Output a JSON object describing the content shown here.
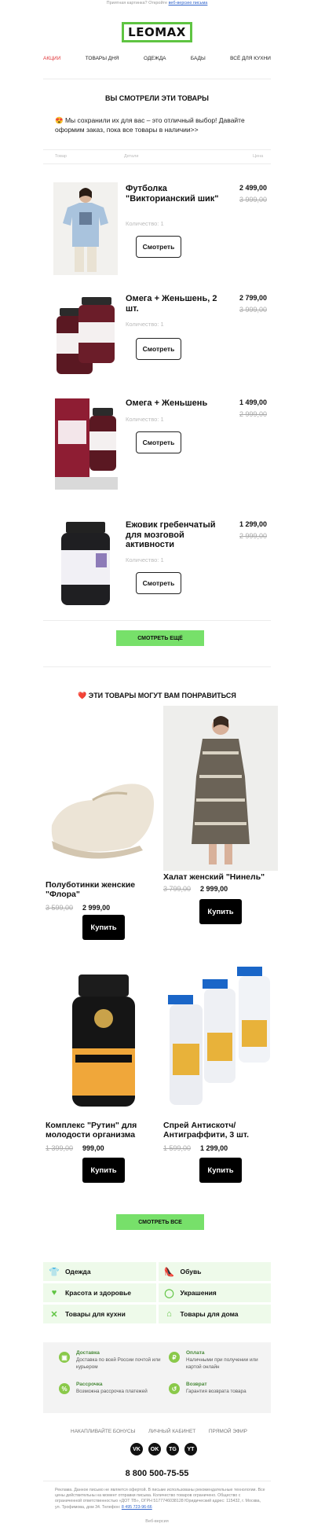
{
  "preheader": {
    "text": "Приятная картинка? Откройте",
    "link": "веб-версию письма"
  },
  "logo": "LEOMAX",
  "nav": [
    "Акции",
    "Товары дня",
    "Одежда",
    "Бады",
    "Всё для кухни"
  ],
  "viewed": {
    "title": "Вы смотрели эти товары",
    "intro": "😍 Мы сохранили их для вас – это отличный выбор! Давайте оформим заказ, пока все товары в наличии>>",
    "col_product": "Товар",
    "col_details": "Детали",
    "col_price": "Цена",
    "items": [
      {
        "name": "Футболка \"Викторианский шик\"",
        "price": "2 499,00",
        "old_price": "3 999,00",
        "qty": "Количество: 1",
        "button": "Смотреть"
      },
      {
        "name": "Омега + Женьшень, 2 шт.",
        "price": "2 799,00",
        "old_price": "3 999,00",
        "qty": "Количество: 1",
        "button": "Смотреть"
      },
      {
        "name": "Омега + Женьшень",
        "price": "1 499,00",
        "old_price": "2 999,00",
        "qty": "Количество: 1",
        "button": "Смотреть"
      },
      {
        "name": "Ежовик гребенчатый для мозговой активности",
        "price": "1 299,00",
        "old_price": "2 999,00",
        "qty": "Количество: 1",
        "button": "Смотреть"
      }
    ],
    "more_button": "Смотреть ещё"
  },
  "recommend": {
    "title": "❤️ Эти товары могут вам понравиться",
    "items": [
      {
        "name": "Полуботинки женские \"Флора\"",
        "old_price": "3 599,00",
        "price": "2 999,00",
        "button": "Купить"
      },
      {
        "name": "Халат женский \"Нинель\"",
        "old_price": "3 799,00",
        "price": "2 999,00",
        "button": "Купить"
      },
      {
        "name": "Комплекс \"Рутин\" для молодости организма",
        "old_price": "1 399,00",
        "price": "999,00",
        "button": "Купить"
      },
      {
        "name": "Спрей Антискотч/Антиграффити, 3 шт.",
        "old_price": "1 599,00",
        "price": "1 299,00",
        "button": "Купить"
      }
    ],
    "all_button": "Смотреть все"
  },
  "categories": [
    "Одежда",
    "Обувь",
    "Красота и здоровье",
    "Украшения",
    "Товары для кухни",
    "Товары для дома"
  ],
  "info": [
    {
      "title": "Доставка",
      "text": "Доставка по всей России почтой или курьером"
    },
    {
      "title": "Оплата",
      "text": "Наличными при получении или картой онлайн"
    },
    {
      "title": "Рассрочка",
      "text": "Возможна рассрочка платежей"
    },
    {
      "title": "Возврат",
      "text": "Гарантия возврата товара"
    }
  ],
  "footer_links": [
    "Накапливайте бонусы",
    "Личный кабинет",
    "Прямой эфир"
  ],
  "socials": [
    "VK",
    "OK",
    "TG",
    "YT"
  ],
  "phone": "8 800 500-75-55",
  "legal": {
    "text": "Реклама. Данное письмо не является офертой. В письме использованы рекомендательные технологии. Все цены действительны на момент отправки письма. Количество товаров ограничено. Общество с ограниченной ответственностью «ДОТ ТВ», ОГРН 5177746038128 Юридический адрес: 115432, г. Москва, ул. Трофимова, дом 34. Телефон:",
    "phone_link": "8 495 723-96-66"
  },
  "webversion": "Веб-версия"
}
